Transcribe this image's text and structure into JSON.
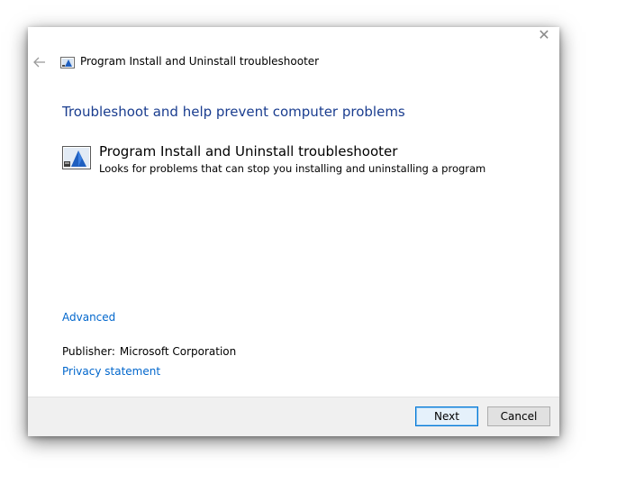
{
  "window": {
    "close_glyph": "✕"
  },
  "titlebar": {
    "back_icon": "back-arrow-icon",
    "app_icon": "troubleshooter-icon",
    "title": "Program Install and Uninstall troubleshooter"
  },
  "main": {
    "heading": "Troubleshoot and help prevent computer problems",
    "item": {
      "icon": "troubleshooter-icon",
      "title": "Program Install and Uninstall troubleshooter",
      "description": "Looks for problems that can stop you installing and uninstalling a program"
    },
    "advanced_link": "Advanced",
    "publisher_label": "Publisher:",
    "publisher_value": "Microsoft Corporation",
    "privacy_link": "Privacy statement"
  },
  "footer": {
    "next_label": "Next",
    "cancel_label": "Cancel"
  },
  "colors": {
    "heading": "#1a3d8f",
    "link": "#0066cc",
    "accent": "#0078d7",
    "footer_bg": "#f0f0f0"
  }
}
